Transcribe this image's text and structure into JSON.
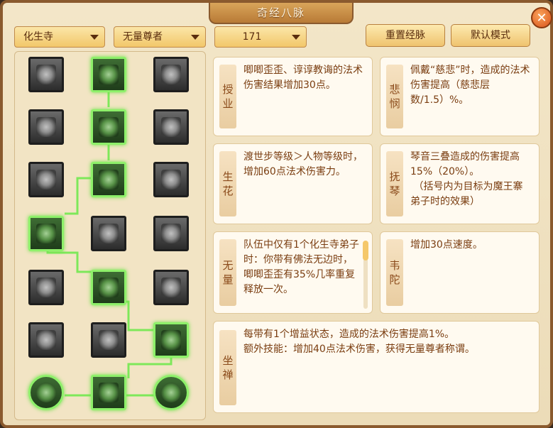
{
  "window": {
    "title": "奇经八脉",
    "close": "✕"
  },
  "selects": {
    "school": "化生寺",
    "mode": "无量尊者",
    "points": "171"
  },
  "buttons": {
    "reset": "重置经脉",
    "default": "默认模式"
  },
  "cards": [
    {
      "title": "授\n业",
      "text": "唧唧歪歪、谆谆教诲的法术伤害结果增加30点。"
    },
    {
      "title": "悲\n悯",
      "text": "佩戴“慈悲”时，造成的法术伤害提高（慈悲层数/1.5）%。"
    },
    {
      "title": "生\n花",
      "text": "渡世步等级＞人物等级时，增加60点法术伤害力。"
    },
    {
      "title": "抚\n琴",
      "text": "琴音三叠造成的伤害提高15%（20%）。\n （括号内为目标为魔王寨弟子时的效果）"
    },
    {
      "title": "无\n量",
      "text": "队伍中仅有1个化生寺弟子时：你带有佛法无边时，唧唧歪歪有35%几率重复释放一次。"
    },
    {
      "title": "韦\n陀",
      "text": "增加30点速度。"
    },
    {
      "title": "坐\n禅",
      "text": "每带有1个增益状态，造成的法术伤害提高1%。\n额外技能：增加40点法术伤害，获得无量尊者称谓。"
    }
  ],
  "nodes": [
    {
      "name": "node-1-1-icon",
      "on": false
    },
    {
      "name": "node-1-2-icon",
      "on": true
    },
    {
      "name": "node-1-3-icon",
      "on": false
    },
    {
      "name": "node-2-1-icon",
      "on": false
    },
    {
      "name": "node-2-2-icon",
      "on": true
    },
    {
      "name": "node-2-3-icon",
      "on": false
    },
    {
      "name": "node-3-1-icon",
      "on": false
    },
    {
      "name": "node-3-2-icon",
      "on": true
    },
    {
      "name": "node-3-3-icon",
      "on": false
    },
    {
      "name": "node-4-1-icon",
      "on": true
    },
    {
      "name": "node-4-2-icon",
      "on": false
    },
    {
      "name": "node-4-3-icon",
      "on": false
    },
    {
      "name": "node-5-1-icon",
      "on": false
    },
    {
      "name": "node-5-2-icon",
      "on": true
    },
    {
      "name": "node-5-3-icon",
      "on": false
    },
    {
      "name": "node-6-1-icon",
      "on": false
    },
    {
      "name": "node-6-2-icon",
      "on": false
    },
    {
      "name": "node-6-3-icon",
      "on": true
    },
    {
      "name": "node-7-1-icon",
      "on": true
    },
    {
      "name": "node-7-2-icon",
      "on": true
    },
    {
      "name": "node-7-3-icon",
      "on": true
    }
  ],
  "colors": {
    "active_link": "#7ee85a",
    "frame": "#8a5a2e"
  }
}
